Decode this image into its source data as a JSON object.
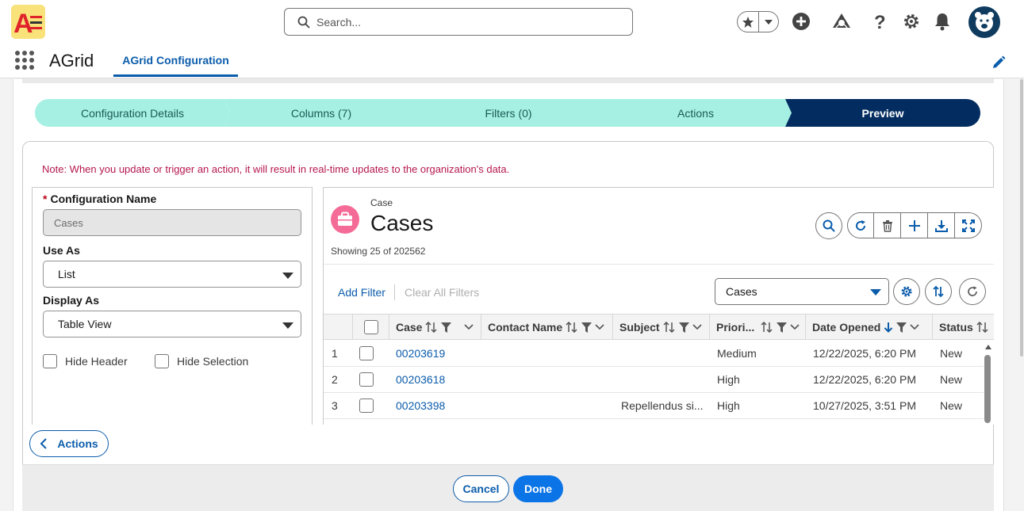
{
  "header": {
    "search_placeholder": "Search..."
  },
  "nav": {
    "app_name": "AGrid",
    "active_tab": "AGrid Configuration"
  },
  "path": {
    "steps": [
      {
        "label": "Configuration Details"
      },
      {
        "label": "Columns (7)"
      },
      {
        "label": "Filters (0)"
      },
      {
        "label": "Actions"
      },
      {
        "label": "Preview"
      }
    ]
  },
  "note": "Note: When you update or trigger an action, it will result in real-time updates to the organization's data.",
  "form": {
    "config_name_label": "Configuration Name",
    "config_name_required": "*",
    "config_name_value": "Cases",
    "use_as_label": "Use As",
    "use_as_value": "List",
    "display_as_label": "Display As",
    "display_as_value": "Table View",
    "hide_header_label": "Hide Header",
    "hide_selection_label": "Hide Selection"
  },
  "grid": {
    "object_subtitle": "Case",
    "object_title": "Cases",
    "count_text": "Showing 25 of 202562",
    "add_filter": "Add Filter",
    "clear_filters": "Clear All Filters",
    "list_view_value": "Cases",
    "columns": [
      {
        "label": "Case"
      },
      {
        "label": "Contact Name"
      },
      {
        "label": "Subject"
      },
      {
        "label": "Priori..."
      },
      {
        "label": "Date Opened"
      },
      {
        "label": "Status"
      }
    ],
    "rows": [
      {
        "num": "1",
        "case": "00203619",
        "contact": "",
        "subject": "",
        "priority": "Medium",
        "date": "12/22/2025, 6:20 PM",
        "status": "New"
      },
      {
        "num": "2",
        "case": "00203618",
        "contact": "",
        "subject": "",
        "priority": "High",
        "date": "12/22/2025, 6:20 PM",
        "status": "New"
      },
      {
        "num": "3",
        "case": "00203398",
        "contact": "",
        "subject": "Repellendus si...",
        "priority": "High",
        "date": "10/27/2025, 3:51 PM",
        "status": "New"
      }
    ]
  },
  "footer": {
    "actions_label": "Actions",
    "cancel_label": "Cancel",
    "done_label": "Done"
  },
  "colors": {
    "brand": "#0b5cab",
    "path_complete": "#a6f0e3",
    "path_current": "#032d60",
    "note_text": "#b5174f",
    "case_icon": "#f56b97"
  },
  "icons": [
    "app-logo",
    "search-icon",
    "favorite-star-icon",
    "chevron-down-icon",
    "add-icon",
    "trailhead-icon",
    "help-icon",
    "gear-icon",
    "bell-icon",
    "avatar",
    "waffle-icon",
    "edit-pencil-icon",
    "briefcase-icon",
    "search-icon",
    "refresh-icon",
    "trash-icon",
    "plus-icon",
    "download-icon",
    "expand-icon",
    "settings-icon",
    "sort-icon",
    "reset-icon",
    "sort-arrows-icon",
    "filter-icon",
    "arrow-down-icon",
    "chevron-left-icon"
  ]
}
